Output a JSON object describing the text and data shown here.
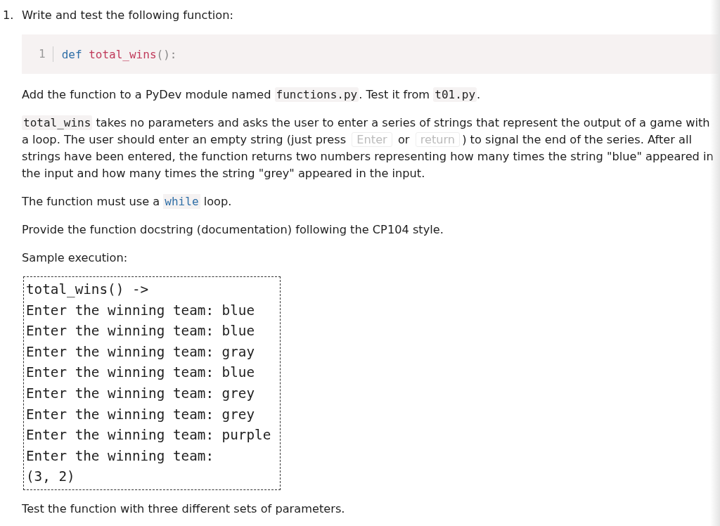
{
  "item": {
    "number": "1.",
    "heading": "Write and test the following function:"
  },
  "code_block": {
    "line_number": "1",
    "tokens": [
      {
        "kind": "keyword",
        "text": "def"
      },
      {
        "kind": "name",
        "text": "total_wins"
      },
      {
        "kind": "punct",
        "text": "():"
      }
    ]
  },
  "paragraphs": [
    {
      "parts": [
        {
          "kind": "text",
          "text": "Add the function to a PyDev module named "
        },
        {
          "kind": "code",
          "text": "functions.py"
        },
        {
          "kind": "text",
          "text": ". Test it from "
        },
        {
          "kind": "code",
          "text": "t01.py"
        },
        {
          "kind": "text",
          "text": "."
        }
      ]
    },
    {
      "parts": [
        {
          "kind": "code",
          "text": "total_wins"
        },
        {
          "kind": "text",
          "text": " takes no parameters and asks the user to enter a series of strings that represent the output of a game with a loop. The user should enter an empty string (just press "
        },
        {
          "kind": "key",
          "text": "Enter"
        },
        {
          "kind": "text",
          "text": " or "
        },
        {
          "kind": "key",
          "text": "return"
        },
        {
          "kind": "text",
          "text": ") to signal the end of the series. After all strings have been entered, the function returns two numbers representing how many times the string \"blue\" appeared in the input and how many times the string \"grey\" appeared in the input."
        }
      ]
    },
    {
      "parts": [
        {
          "kind": "text",
          "text": "The function must use a "
        },
        {
          "kind": "keyword",
          "text": "while"
        },
        {
          "kind": "text",
          "text": " loop."
        }
      ]
    },
    {
      "parts": [
        {
          "kind": "text",
          "text": "Provide the function docstring (documentation) following the CP104 style."
        }
      ]
    },
    {
      "parts": [
        {
          "kind": "text",
          "text": "Sample execution:"
        }
      ]
    }
  ],
  "sample_output": [
    "total_wins() ->",
    "Enter the winning team: blue",
    "Enter the winning team: blue",
    "Enter the winning team: gray",
    "Enter the winning team: blue",
    "Enter the winning team: grey",
    "Enter the winning team: grey",
    "Enter the winning team: purple",
    "Enter the winning team:",
    "(3, 2)"
  ],
  "footer": "Test the function with three different sets of parameters."
}
